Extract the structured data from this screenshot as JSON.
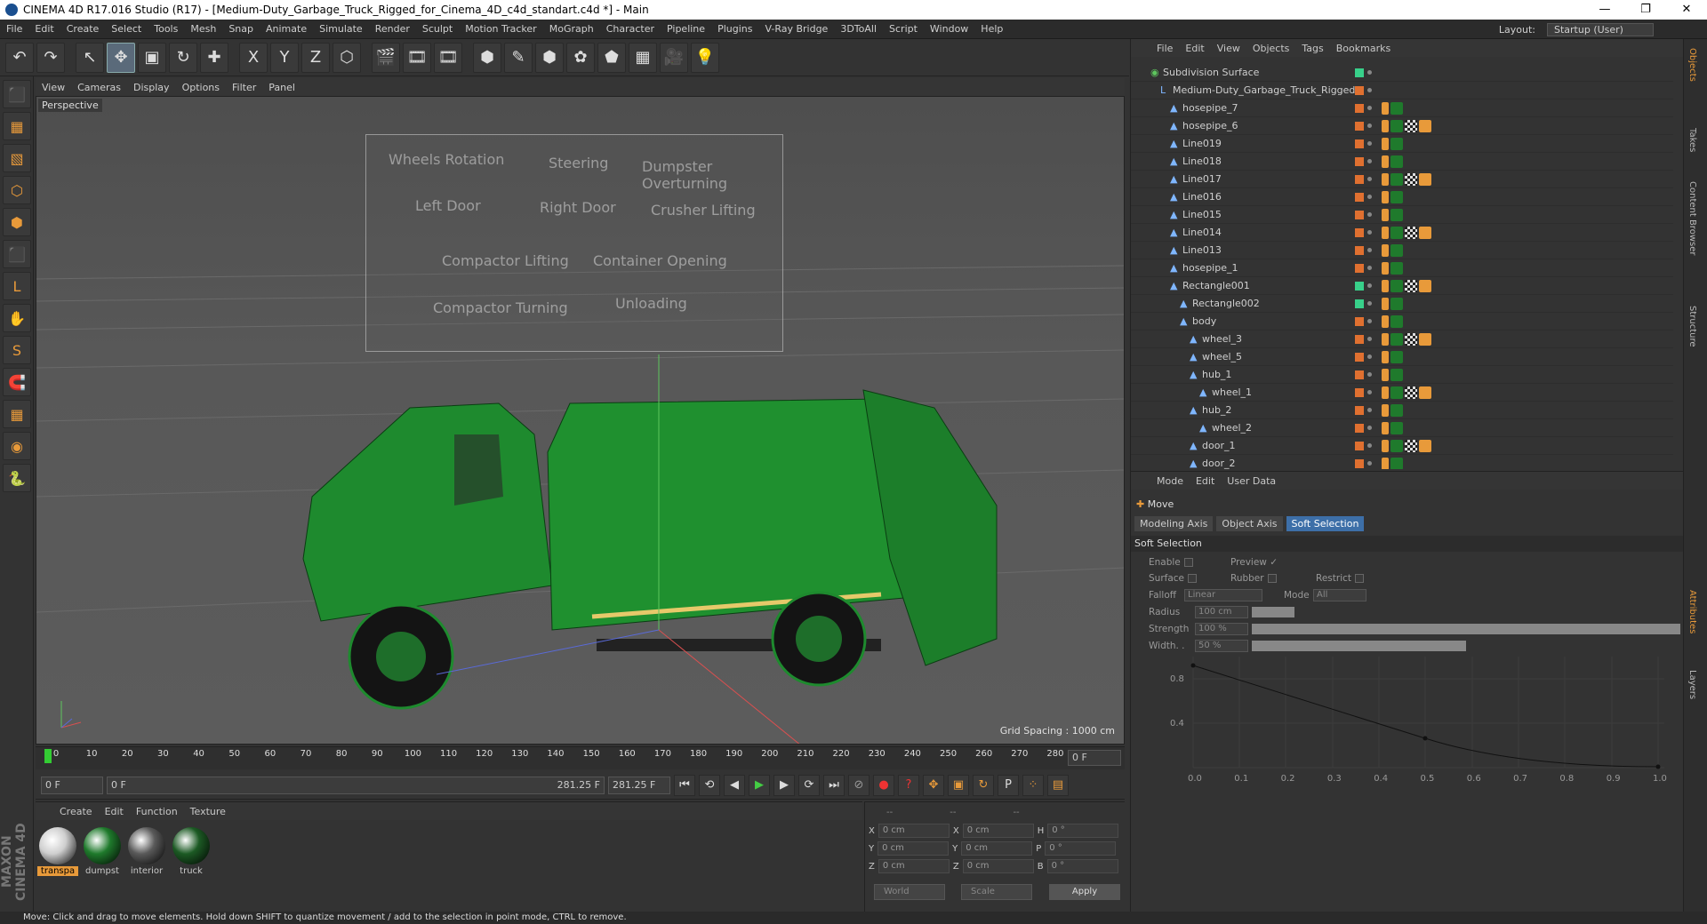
{
  "window": {
    "title": "CINEMA 4D R17.016 Studio (R17) - [Medium-Duty_Garbage_Truck_Rigged_for_Cinema_4D_c4d_standart.c4d *] - Main",
    "controls": [
      "—",
      "❐",
      "✕"
    ]
  },
  "menu": [
    "File",
    "Edit",
    "Create",
    "Select",
    "Tools",
    "Mesh",
    "Snap",
    "Animate",
    "Simulate",
    "Render",
    "Sculpt",
    "Motion Tracker",
    "MoGraph",
    "Character",
    "Pipeline",
    "Plugins",
    "V-Ray Bridge",
    "3DToAll",
    "Script",
    "Window",
    "Help"
  ],
  "layout": {
    "label": "Layout:",
    "value": "Startup (User)"
  },
  "toolbar": [
    "↶",
    "↷",
    "↖",
    "✥",
    "▣",
    "↻",
    "✚",
    "X",
    "Y",
    "Z",
    "⬡",
    "🎬",
    "🎞",
    "🎞",
    "⬢",
    "✎",
    "⬢",
    "✿",
    "⬟",
    "▦",
    "🎥",
    "💡"
  ],
  "left_tools": [
    "⬛",
    "▦",
    "▧",
    "⬡",
    "⬢",
    "⬛",
    "L",
    "✋",
    "S",
    "🧲",
    "▦",
    "◉",
    "🐍"
  ],
  "viewport": {
    "menu": [
      "View",
      "Cameras",
      "Display",
      "Options",
      "Filter",
      "Panel"
    ],
    "label": "Perspective",
    "grid_spacing": "Grid Spacing : 1000 cm",
    "hud_labels": [
      "Wheels Rotation",
      "Steering",
      "Dumpster Overturning",
      "Left Door",
      "Right Door",
      "Crusher Lifting",
      "Compactor Lifting",
      "Container Opening",
      "Compactor Turning",
      "Unloading"
    ]
  },
  "timeline": {
    "ticks": [
      "0",
      "10",
      "20",
      "30",
      "40",
      "50",
      "60",
      "70",
      "80",
      "90",
      "100",
      "110",
      "120",
      "130",
      "140",
      "150",
      "160",
      "170",
      "180",
      "190",
      "200",
      "210",
      "220",
      "230",
      "240",
      "250",
      "260",
      "270",
      "280"
    ],
    "current_frame": "0 F"
  },
  "transport": {
    "start": "0 F",
    "range_start": "0 F",
    "range_end": "281.25 F",
    "end": "281.25 F"
  },
  "materials": {
    "menu": [
      "Create",
      "Edit",
      "Function",
      "Texture"
    ],
    "items": [
      {
        "name": "transpa",
        "color": "#cfcfcf"
      },
      {
        "name": "dumpst",
        "color": "#1f7a2c"
      },
      {
        "name": "interior",
        "color": "#5a5a5a"
      },
      {
        "name": "truck",
        "color": "#1c5a24"
      }
    ]
  },
  "coords": {
    "headers": [
      "--",
      "--",
      "--"
    ],
    "rows": [
      {
        "a": "X",
        "av": "0 cm",
        "b": "X",
        "bv": "0 cm",
        "c": "H",
        "cv": "0 °"
      },
      {
        "a": "Y",
        "av": "0 cm",
        "b": "Y",
        "bv": "0 cm",
        "c": "P",
        "cv": "0 °"
      },
      {
        "a": "Z",
        "av": "0 cm",
        "b": "Z",
        "bv": "0 cm",
        "c": "B",
        "cv": "0 °"
      }
    ],
    "world": "World",
    "scale": "Scale",
    "apply": "Apply"
  },
  "objects": {
    "menu": [
      "File",
      "Edit",
      "View",
      "Objects",
      "Tags",
      "Bookmarks"
    ],
    "rows": [
      {
        "name": "Subdivision Surface",
        "indent": 0,
        "vis": "g"
      },
      {
        "name": "Medium-Duty_Garbage_Truck_Rigged",
        "indent": 1,
        "vis": "o"
      },
      {
        "name": "hosepipe_7",
        "indent": 2,
        "vis": "o"
      },
      {
        "name": "hosepipe_6",
        "indent": 2,
        "vis": "o"
      },
      {
        "name": "Line019",
        "indent": 2,
        "vis": "o"
      },
      {
        "name": "Line018",
        "indent": 2,
        "vis": "o"
      },
      {
        "name": "Line017",
        "indent": 2,
        "vis": "o"
      },
      {
        "name": "Line016",
        "indent": 2,
        "vis": "o"
      },
      {
        "name": "Line015",
        "indent": 2,
        "vis": "o"
      },
      {
        "name": "Line014",
        "indent": 2,
        "vis": "o"
      },
      {
        "name": "Line013",
        "indent": 2,
        "vis": "o"
      },
      {
        "name": "hosepipe_1",
        "indent": 2,
        "vis": "o"
      },
      {
        "name": "Rectangle001",
        "indent": 2,
        "vis": "g"
      },
      {
        "name": "Rectangle002",
        "indent": 3,
        "vis": "g"
      },
      {
        "name": "body",
        "indent": 3,
        "vis": "o"
      },
      {
        "name": "wheel_3",
        "indent": 4,
        "vis": "o"
      },
      {
        "name": "wheel_5",
        "indent": 4,
        "vis": "o"
      },
      {
        "name": "hub_1",
        "indent": 4,
        "vis": "o"
      },
      {
        "name": "wheel_1",
        "indent": 5,
        "vis": "o"
      },
      {
        "name": "hub_2",
        "indent": 4,
        "vis": "o"
      },
      {
        "name": "wheel_2",
        "indent": 5,
        "vis": "o"
      },
      {
        "name": "door_1",
        "indent": 4,
        "vis": "o"
      },
      {
        "name": "door_2",
        "indent": 4,
        "vis": "o"
      }
    ]
  },
  "attributes": {
    "menu": [
      "Mode",
      "Edit",
      "User Data"
    ],
    "tool": "Move",
    "tabs": [
      "Modeling Axis",
      "Object Axis",
      "Soft Selection"
    ],
    "section": "Soft Selection",
    "enable": "Enable",
    "preview": "Preview",
    "surface": "Surface",
    "rubber": "Rubber",
    "restrict": "Restrict",
    "falloff": "Falloff",
    "falloff_value": "Linear",
    "mode": "Mode",
    "mode_value": "All",
    "radius": "Radius",
    "radius_value": "100 cm",
    "strength": "Strength",
    "strength_value": "100 %",
    "width": "Width. .",
    "width_value": "50 %",
    "curve_x": [
      "0.0",
      "0.1",
      "0.2",
      "0.3",
      "0.4",
      "0.5",
      "0.6",
      "0.7",
      "0.8",
      "0.9",
      "1.0"
    ],
    "curve_y": [
      "0.8",
      "0.4"
    ]
  },
  "right_tabs": [
    "Objects",
    "Takes",
    "Content Browser",
    "Structure",
    "Attributes",
    "Layers"
  ],
  "brand": "MAXON CINEMA 4D",
  "status": "Move: Click and drag to move elements. Hold down SHIFT to quantize movement / add to the selection in point mode, CTRL to remove."
}
